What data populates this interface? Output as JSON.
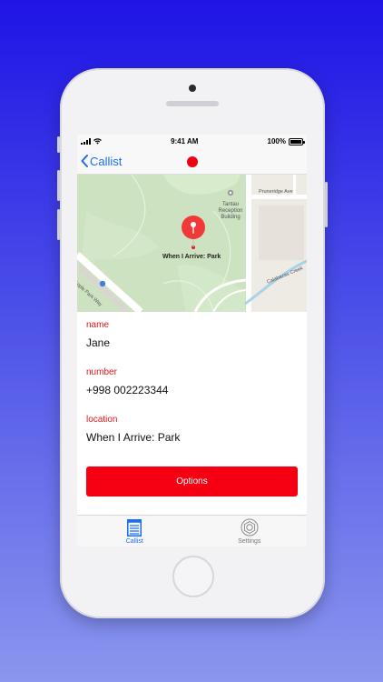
{
  "status_bar": {
    "time": "9:41 AM",
    "battery": "100%"
  },
  "nav": {
    "back_label": "Callist",
    "record_color": "#f00010"
  },
  "map": {
    "pin_label": "When I Arrive: Park",
    "poi_label": "Tantau Reception Building",
    "road_labels": [
      "Pruneridge Ave",
      "Calabazas Creek",
      "Apple Park Way"
    ]
  },
  "details": {
    "name_label": "name",
    "name_value": "Jane",
    "number_label": "number",
    "number_value": "+998 002223344",
    "location_label": "location",
    "location_value": "When I Arrive: Park"
  },
  "options_button": {
    "label": "Options",
    "color": "#f40012"
  },
  "tab_bar": {
    "tabs": [
      {
        "label": "Callist",
        "icon": "list-icon",
        "selected": true
      },
      {
        "label": "Settings",
        "icon": "gear-icon",
        "selected": false
      }
    ]
  },
  "colors": {
    "accent": "#1a6cf5",
    "label_red": "#e4141c"
  }
}
